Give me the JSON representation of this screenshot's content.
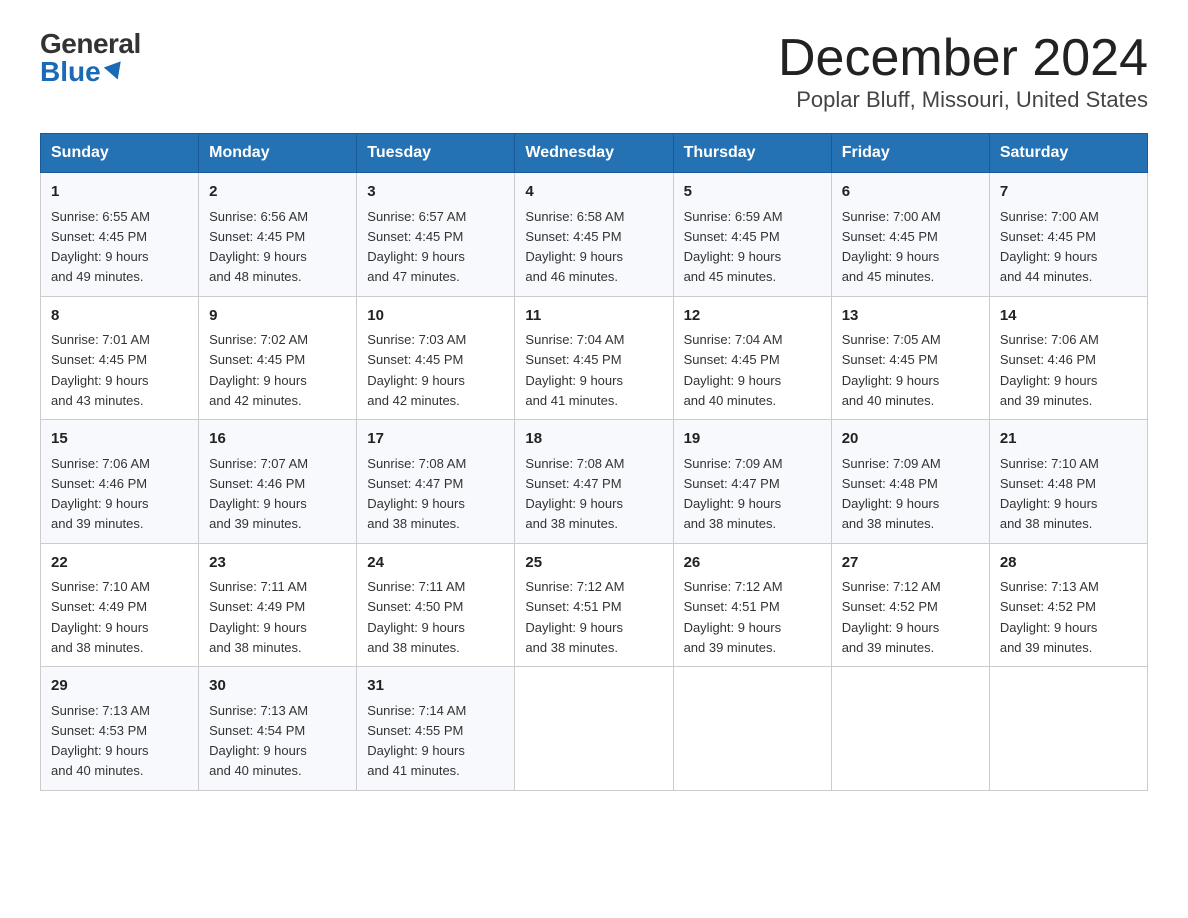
{
  "header": {
    "logo_general": "General",
    "logo_blue": "Blue",
    "month_title": "December 2024",
    "location": "Poplar Bluff, Missouri, United States"
  },
  "weekdays": [
    "Sunday",
    "Monday",
    "Tuesday",
    "Wednesday",
    "Thursday",
    "Friday",
    "Saturday"
  ],
  "weeks": [
    [
      {
        "day": "1",
        "sunrise": "6:55 AM",
        "sunset": "4:45 PM",
        "daylight": "9 hours and 49 minutes."
      },
      {
        "day": "2",
        "sunrise": "6:56 AM",
        "sunset": "4:45 PM",
        "daylight": "9 hours and 48 minutes."
      },
      {
        "day": "3",
        "sunrise": "6:57 AM",
        "sunset": "4:45 PM",
        "daylight": "9 hours and 47 minutes."
      },
      {
        "day": "4",
        "sunrise": "6:58 AM",
        "sunset": "4:45 PM",
        "daylight": "9 hours and 46 minutes."
      },
      {
        "day": "5",
        "sunrise": "6:59 AM",
        "sunset": "4:45 PM",
        "daylight": "9 hours and 45 minutes."
      },
      {
        "day": "6",
        "sunrise": "7:00 AM",
        "sunset": "4:45 PM",
        "daylight": "9 hours and 45 minutes."
      },
      {
        "day": "7",
        "sunrise": "7:00 AM",
        "sunset": "4:45 PM",
        "daylight": "9 hours and 44 minutes."
      }
    ],
    [
      {
        "day": "8",
        "sunrise": "7:01 AM",
        "sunset": "4:45 PM",
        "daylight": "9 hours and 43 minutes."
      },
      {
        "day": "9",
        "sunrise": "7:02 AM",
        "sunset": "4:45 PM",
        "daylight": "9 hours and 42 minutes."
      },
      {
        "day": "10",
        "sunrise": "7:03 AM",
        "sunset": "4:45 PM",
        "daylight": "9 hours and 42 minutes."
      },
      {
        "day": "11",
        "sunrise": "7:04 AM",
        "sunset": "4:45 PM",
        "daylight": "9 hours and 41 minutes."
      },
      {
        "day": "12",
        "sunrise": "7:04 AM",
        "sunset": "4:45 PM",
        "daylight": "9 hours and 40 minutes."
      },
      {
        "day": "13",
        "sunrise": "7:05 AM",
        "sunset": "4:45 PM",
        "daylight": "9 hours and 40 minutes."
      },
      {
        "day": "14",
        "sunrise": "7:06 AM",
        "sunset": "4:46 PM",
        "daylight": "9 hours and 39 minutes."
      }
    ],
    [
      {
        "day": "15",
        "sunrise": "7:06 AM",
        "sunset": "4:46 PM",
        "daylight": "9 hours and 39 minutes."
      },
      {
        "day": "16",
        "sunrise": "7:07 AM",
        "sunset": "4:46 PM",
        "daylight": "9 hours and 39 minutes."
      },
      {
        "day": "17",
        "sunrise": "7:08 AM",
        "sunset": "4:47 PM",
        "daylight": "9 hours and 38 minutes."
      },
      {
        "day": "18",
        "sunrise": "7:08 AM",
        "sunset": "4:47 PM",
        "daylight": "9 hours and 38 minutes."
      },
      {
        "day": "19",
        "sunrise": "7:09 AM",
        "sunset": "4:47 PM",
        "daylight": "9 hours and 38 minutes."
      },
      {
        "day": "20",
        "sunrise": "7:09 AM",
        "sunset": "4:48 PM",
        "daylight": "9 hours and 38 minutes."
      },
      {
        "day": "21",
        "sunrise": "7:10 AM",
        "sunset": "4:48 PM",
        "daylight": "9 hours and 38 minutes."
      }
    ],
    [
      {
        "day": "22",
        "sunrise": "7:10 AM",
        "sunset": "4:49 PM",
        "daylight": "9 hours and 38 minutes."
      },
      {
        "day": "23",
        "sunrise": "7:11 AM",
        "sunset": "4:49 PM",
        "daylight": "9 hours and 38 minutes."
      },
      {
        "day": "24",
        "sunrise": "7:11 AM",
        "sunset": "4:50 PM",
        "daylight": "9 hours and 38 minutes."
      },
      {
        "day": "25",
        "sunrise": "7:12 AM",
        "sunset": "4:51 PM",
        "daylight": "9 hours and 38 minutes."
      },
      {
        "day": "26",
        "sunrise": "7:12 AM",
        "sunset": "4:51 PM",
        "daylight": "9 hours and 39 minutes."
      },
      {
        "day": "27",
        "sunrise": "7:12 AM",
        "sunset": "4:52 PM",
        "daylight": "9 hours and 39 minutes."
      },
      {
        "day": "28",
        "sunrise": "7:13 AM",
        "sunset": "4:52 PM",
        "daylight": "9 hours and 39 minutes."
      }
    ],
    [
      {
        "day": "29",
        "sunrise": "7:13 AM",
        "sunset": "4:53 PM",
        "daylight": "9 hours and 40 minutes."
      },
      {
        "day": "30",
        "sunrise": "7:13 AM",
        "sunset": "4:54 PM",
        "daylight": "9 hours and 40 minutes."
      },
      {
        "day": "31",
        "sunrise": "7:14 AM",
        "sunset": "4:55 PM",
        "daylight": "9 hours and 41 minutes."
      },
      null,
      null,
      null,
      null
    ]
  ],
  "labels": {
    "sunrise": "Sunrise:",
    "sunset": "Sunset:",
    "daylight": "Daylight:"
  }
}
